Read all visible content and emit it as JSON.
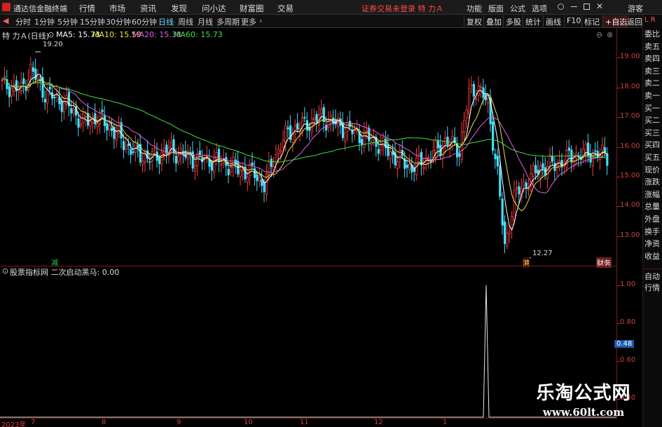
{
  "menubar": {
    "app_title": "通达信金融终端",
    "menus": [
      "行情",
      "市场",
      "资讯",
      "发现",
      "问小达",
      "财富圈",
      "交易"
    ],
    "warning": "证券交易未登录  特 力Ａ",
    "right_menus": [
      "功能",
      "版面",
      "公式",
      "选项",
      "游客"
    ]
  },
  "periodbar": {
    "tabs": [
      "分时",
      "1分钟",
      "5分钟",
      "15分钟",
      "30分钟",
      "60分钟",
      "日线",
      "周线",
      "月线",
      "多周期",
      "更多"
    ],
    "active_tab": "日线",
    "tools": [
      "复权",
      "叠加",
      "多股",
      "统计",
      "画线",
      "F10",
      "标记",
      "+自选",
      "返回"
    ]
  },
  "chart_head": {
    "stock": "特 力Ａ(日线)",
    "ma": [
      {
        "label": "MA5: 15.73",
        "color": "#ffffff"
      },
      {
        "label": "MA10: 15.59",
        "color": "#f0e040"
      },
      {
        "label": "MA20: 15.38",
        "color": "#e060e0"
      },
      {
        "label": "MA60: 15.73",
        "color": "#40e040"
      }
    ]
  },
  "main_axis": {
    "labels": [
      "19.00",
      "18.00",
      "17.00",
      "16.00",
      "15.00",
      "14.00",
      "13.00"
    ]
  },
  "annotations": {
    "high": "19.20",
    "low": "12.27",
    "tag_left": "减",
    "tag_low": "港",
    "tag_right": "财务"
  },
  "indicator": {
    "title": "股票指标网 二次启动黑马: 0.00",
    "axis": [
      "1.00",
      "0.80",
      "0.60",
      "0.40"
    ],
    "current": "0.48"
  },
  "side_panel": {
    "top": "L R",
    "items": [
      "委比",
      "卖五",
      "卖四",
      "卖三",
      "卖二",
      "卖一",
      "买一",
      "买二",
      "买三",
      "买四",
      "买五",
      "现价",
      "涨跌",
      "涨幅",
      "总量",
      "外盘",
      "换手",
      "净资",
      "收益"
    ],
    "bottom_items": [
      "自动",
      "行情"
    ]
  },
  "date_axis": {
    "labels": [
      "2023年",
      "7",
      "8",
      "9",
      "10",
      "11",
      "12",
      "1"
    ]
  },
  "watermark": {
    "title": "乐淘公式网",
    "url": "www.60lt.com"
  },
  "chart_data": {
    "type": "candlestick",
    "ylim": [
      12.0,
      19.6
    ],
    "high": 19.2,
    "low": 12.27,
    "ma_last": {
      "MA5": 15.73,
      "MA10": 15.59,
      "MA20": 15.38,
      "MA60": 15.73
    },
    "indicator": {
      "name": "二次启动黑马",
      "value": 0.0,
      "spike": 1.0,
      "ylim": [
        0.3,
        1.05
      ]
    }
  },
  "colors": {
    "up": "#ff3c3c",
    "down": "#40e0ff",
    "axis": "#d04040"
  }
}
